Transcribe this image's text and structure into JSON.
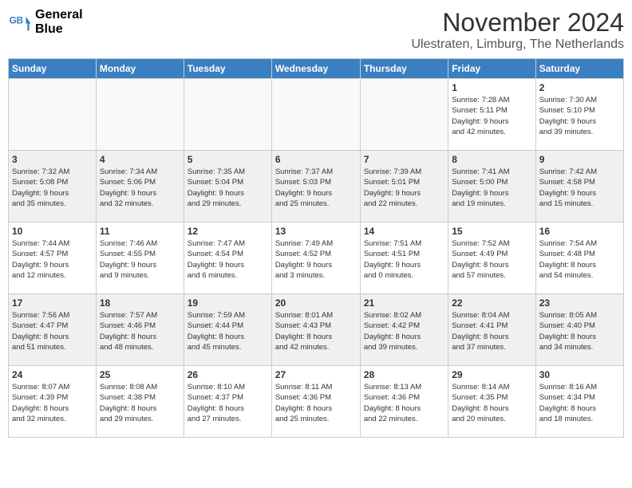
{
  "header": {
    "logo_line1": "General",
    "logo_line2": "Blue",
    "month_title": "November 2024",
    "location": "Ulestraten, Limburg, The Netherlands"
  },
  "days_of_week": [
    "Sunday",
    "Monday",
    "Tuesday",
    "Wednesday",
    "Thursday",
    "Friday",
    "Saturday"
  ],
  "weeks": [
    {
      "shaded": false,
      "days": [
        {
          "num": "",
          "info": ""
        },
        {
          "num": "",
          "info": ""
        },
        {
          "num": "",
          "info": ""
        },
        {
          "num": "",
          "info": ""
        },
        {
          "num": "",
          "info": ""
        },
        {
          "num": "1",
          "info": "Sunrise: 7:28 AM\nSunset: 5:11 PM\nDaylight: 9 hours\nand 42 minutes."
        },
        {
          "num": "2",
          "info": "Sunrise: 7:30 AM\nSunset: 5:10 PM\nDaylight: 9 hours\nand 39 minutes."
        }
      ]
    },
    {
      "shaded": true,
      "days": [
        {
          "num": "3",
          "info": "Sunrise: 7:32 AM\nSunset: 5:08 PM\nDaylight: 9 hours\nand 35 minutes."
        },
        {
          "num": "4",
          "info": "Sunrise: 7:34 AM\nSunset: 5:06 PM\nDaylight: 9 hours\nand 32 minutes."
        },
        {
          "num": "5",
          "info": "Sunrise: 7:35 AM\nSunset: 5:04 PM\nDaylight: 9 hours\nand 29 minutes."
        },
        {
          "num": "6",
          "info": "Sunrise: 7:37 AM\nSunset: 5:03 PM\nDaylight: 9 hours\nand 25 minutes."
        },
        {
          "num": "7",
          "info": "Sunrise: 7:39 AM\nSunset: 5:01 PM\nDaylight: 9 hours\nand 22 minutes."
        },
        {
          "num": "8",
          "info": "Sunrise: 7:41 AM\nSunset: 5:00 PM\nDaylight: 9 hours\nand 19 minutes."
        },
        {
          "num": "9",
          "info": "Sunrise: 7:42 AM\nSunset: 4:58 PM\nDaylight: 9 hours\nand 15 minutes."
        }
      ]
    },
    {
      "shaded": false,
      "days": [
        {
          "num": "10",
          "info": "Sunrise: 7:44 AM\nSunset: 4:57 PM\nDaylight: 9 hours\nand 12 minutes."
        },
        {
          "num": "11",
          "info": "Sunrise: 7:46 AM\nSunset: 4:55 PM\nDaylight: 9 hours\nand 9 minutes."
        },
        {
          "num": "12",
          "info": "Sunrise: 7:47 AM\nSunset: 4:54 PM\nDaylight: 9 hours\nand 6 minutes."
        },
        {
          "num": "13",
          "info": "Sunrise: 7:49 AM\nSunset: 4:52 PM\nDaylight: 9 hours\nand 3 minutes."
        },
        {
          "num": "14",
          "info": "Sunrise: 7:51 AM\nSunset: 4:51 PM\nDaylight: 9 hours\nand 0 minutes."
        },
        {
          "num": "15",
          "info": "Sunrise: 7:52 AM\nSunset: 4:49 PM\nDaylight: 8 hours\nand 57 minutes."
        },
        {
          "num": "16",
          "info": "Sunrise: 7:54 AM\nSunset: 4:48 PM\nDaylight: 8 hours\nand 54 minutes."
        }
      ]
    },
    {
      "shaded": true,
      "days": [
        {
          "num": "17",
          "info": "Sunrise: 7:56 AM\nSunset: 4:47 PM\nDaylight: 8 hours\nand 51 minutes."
        },
        {
          "num": "18",
          "info": "Sunrise: 7:57 AM\nSunset: 4:46 PM\nDaylight: 8 hours\nand 48 minutes."
        },
        {
          "num": "19",
          "info": "Sunrise: 7:59 AM\nSunset: 4:44 PM\nDaylight: 8 hours\nand 45 minutes."
        },
        {
          "num": "20",
          "info": "Sunrise: 8:01 AM\nSunset: 4:43 PM\nDaylight: 8 hours\nand 42 minutes."
        },
        {
          "num": "21",
          "info": "Sunrise: 8:02 AM\nSunset: 4:42 PM\nDaylight: 8 hours\nand 39 minutes."
        },
        {
          "num": "22",
          "info": "Sunrise: 8:04 AM\nSunset: 4:41 PM\nDaylight: 8 hours\nand 37 minutes."
        },
        {
          "num": "23",
          "info": "Sunrise: 8:05 AM\nSunset: 4:40 PM\nDaylight: 8 hours\nand 34 minutes."
        }
      ]
    },
    {
      "shaded": false,
      "days": [
        {
          "num": "24",
          "info": "Sunrise: 8:07 AM\nSunset: 4:39 PM\nDaylight: 8 hours\nand 32 minutes."
        },
        {
          "num": "25",
          "info": "Sunrise: 8:08 AM\nSunset: 4:38 PM\nDaylight: 8 hours\nand 29 minutes."
        },
        {
          "num": "26",
          "info": "Sunrise: 8:10 AM\nSunset: 4:37 PM\nDaylight: 8 hours\nand 27 minutes."
        },
        {
          "num": "27",
          "info": "Sunrise: 8:11 AM\nSunset: 4:36 PM\nDaylight: 8 hours\nand 25 minutes."
        },
        {
          "num": "28",
          "info": "Sunrise: 8:13 AM\nSunset: 4:36 PM\nDaylight: 8 hours\nand 22 minutes."
        },
        {
          "num": "29",
          "info": "Sunrise: 8:14 AM\nSunset: 4:35 PM\nDaylight: 8 hours\nand 20 minutes."
        },
        {
          "num": "30",
          "info": "Sunrise: 8:16 AM\nSunset: 4:34 PM\nDaylight: 8 hours\nand 18 minutes."
        }
      ]
    }
  ]
}
